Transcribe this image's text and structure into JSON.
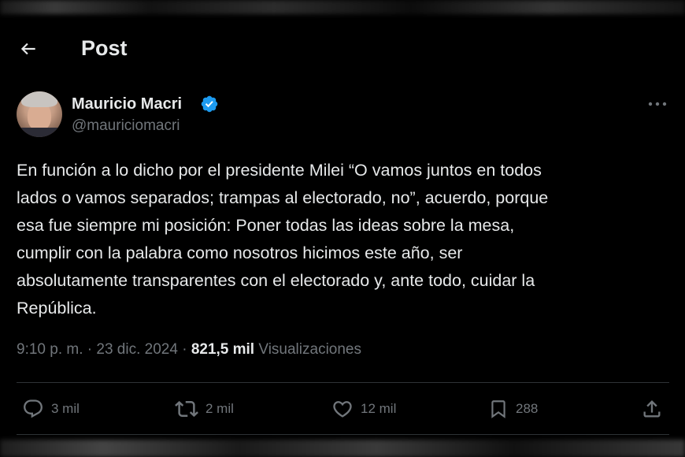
{
  "header": {
    "title": "Post"
  },
  "author": {
    "name": "Mauricio Macri",
    "handle": "@mauriciomacri",
    "verified": true
  },
  "post": {
    "text": "En función a lo dicho por el presidente Milei “O vamos juntos en todos\nlados o vamos separados; trampas al electorado, no”, acuerdo, porque\nesa fue siempre mi posición: Poner todas las ideas sobre la mesa,\ncumplir con la palabra como nosotros hicimos este año, ser\nabsolutamente transparentes con el electorado y, ante todo, cuidar la\nRepública.",
    "time": "9:10 p. m.",
    "separator": "·",
    "date": "23 dic. 2024",
    "views_count": "821,5 mil",
    "views_label": "Visualizaciones"
  },
  "actions": {
    "replies": "3 mil",
    "reposts": "2 mil",
    "likes": "12 mil",
    "bookmarks": "288"
  },
  "colors": {
    "background": "#000000",
    "text_primary": "#e7e9ea",
    "text_secondary": "#71767b",
    "verified_badge": "#1d9bf0",
    "divider": "#2f3336"
  },
  "icons": {
    "back": "arrow-left-icon",
    "verified": "verified-badge-icon",
    "more": "more-horizontal-icon",
    "reply": "reply-icon",
    "repost": "repost-icon",
    "like": "heart-icon",
    "bookmark": "bookmark-icon",
    "share": "share-icon"
  }
}
